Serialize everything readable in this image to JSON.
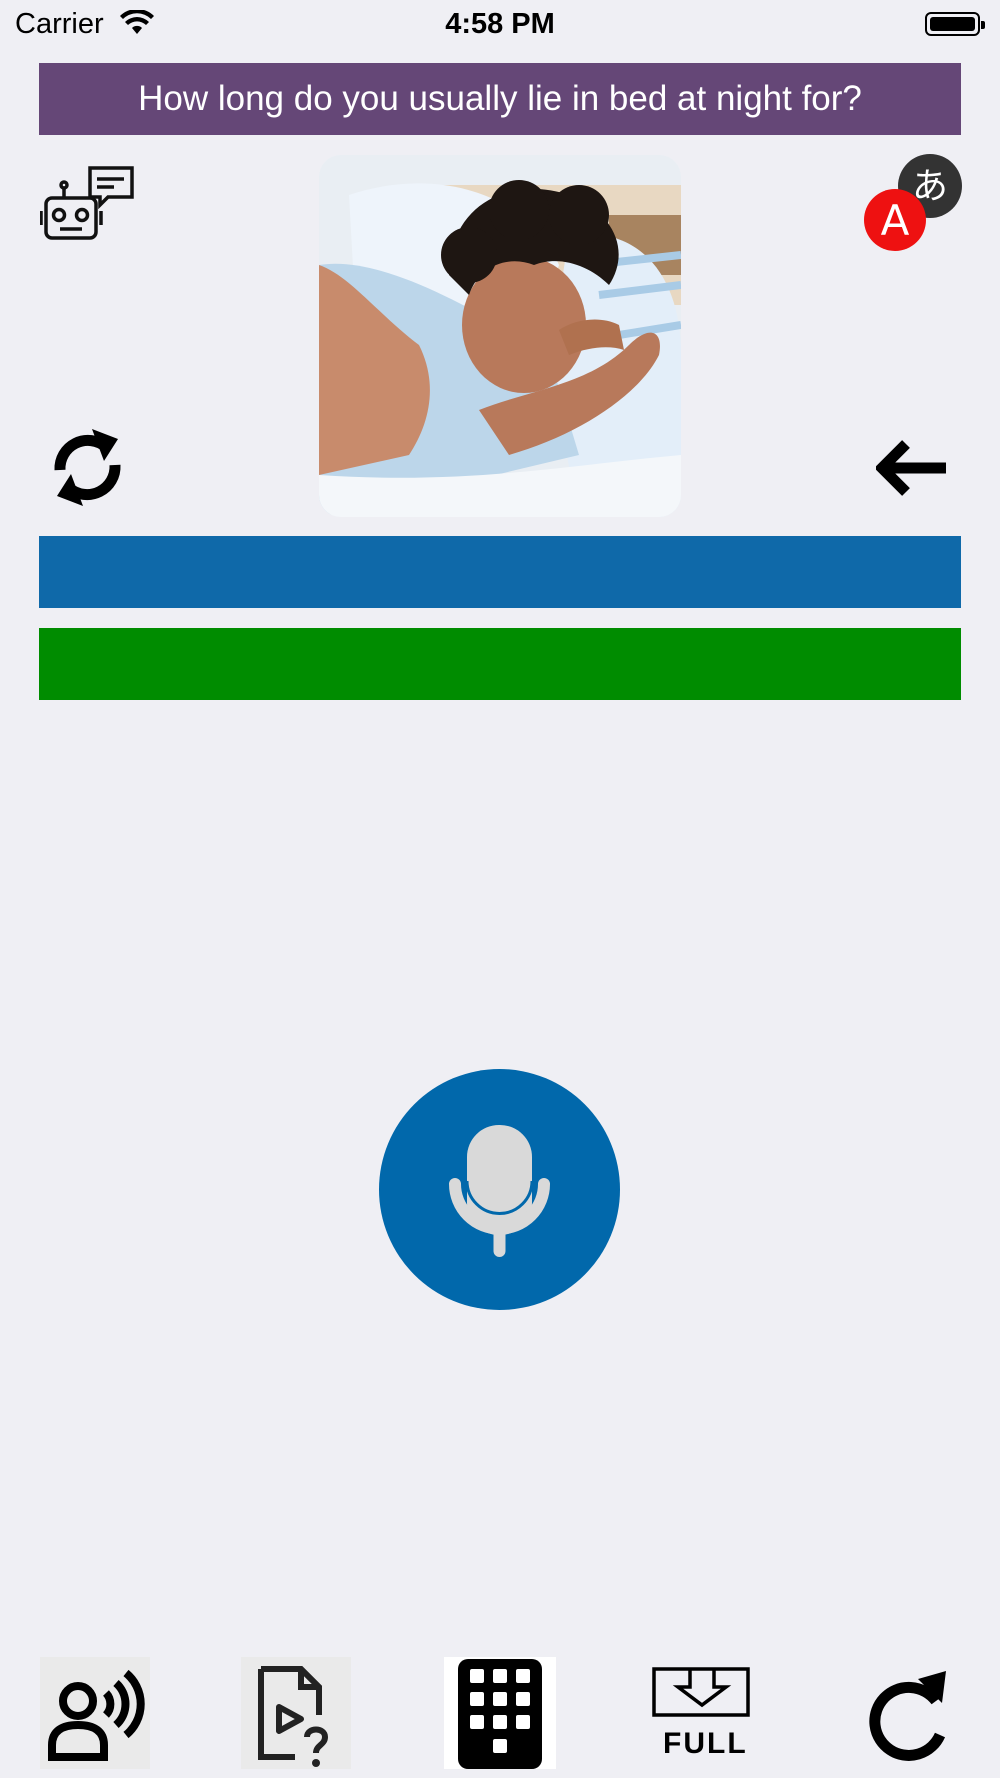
{
  "status": {
    "carrier": "Carrier",
    "time": "4:58 PM"
  },
  "question": "How long do you usually lie in bed at night for?",
  "icons": {
    "chatbot": "robot-chat-icon",
    "translate": "translate-icon",
    "refresh": "sync-icon",
    "back": "arrow-left-icon",
    "mic": "microphone-icon"
  },
  "answer_bars": [
    {
      "color": "#0f69a9",
      "text": ""
    },
    {
      "color": "#008c00",
      "text": ""
    }
  ],
  "bottom_bar": [
    {
      "icon": "speaker-voice-icon",
      "label": ""
    },
    {
      "icon": "video-file-question-icon",
      "label": ""
    },
    {
      "icon": "keypad-icon",
      "label": ""
    },
    {
      "icon": "full-download-icon",
      "label": "FULL"
    },
    {
      "icon": "reload-icon",
      "label": ""
    }
  ],
  "colors": {
    "banner": "#654777",
    "mic": "#0168ab",
    "background": "#efeff4"
  }
}
